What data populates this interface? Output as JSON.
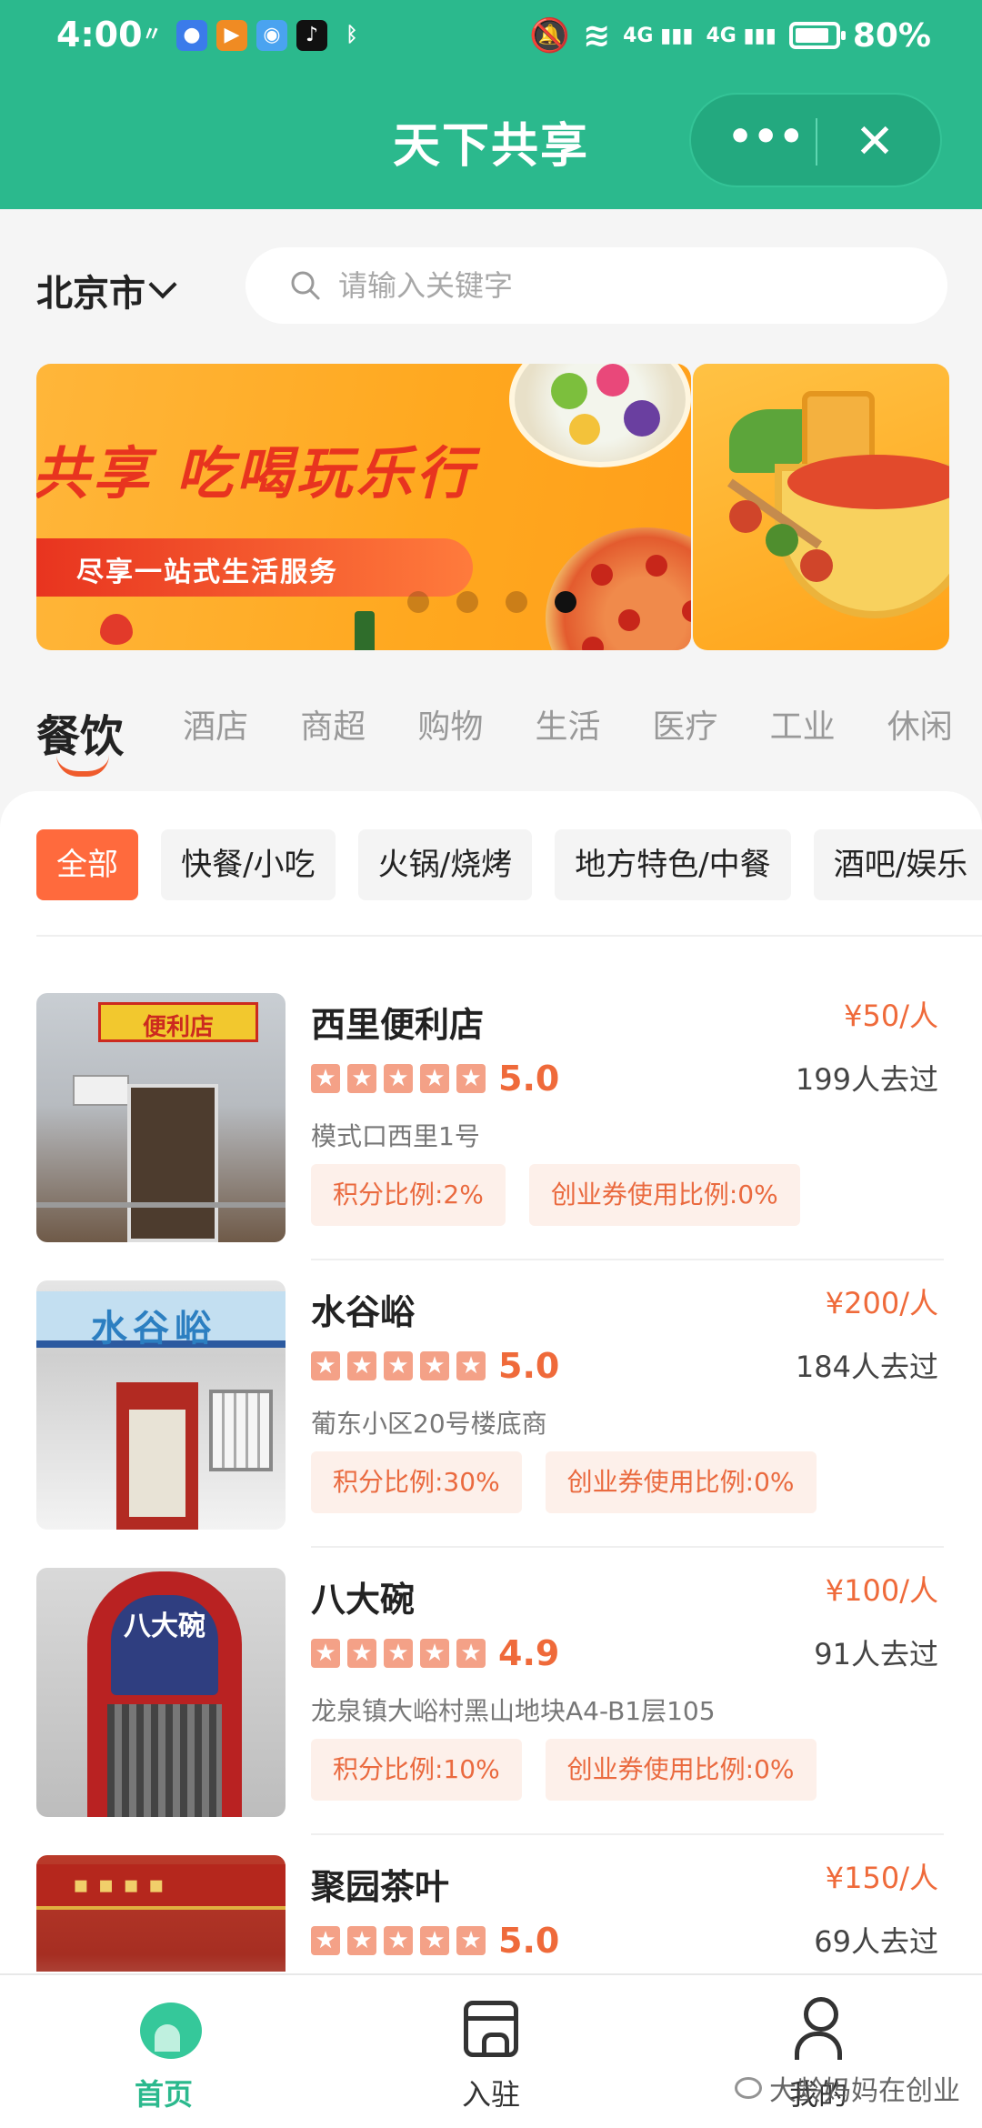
{
  "status_bar": {
    "time": "4:00",
    "battery": "80%",
    "network_1": "4G",
    "network_2": "4G"
  },
  "nav": {
    "title": "天下共享",
    "more_icon": "more-dots-icon",
    "close_icon": "close-icon"
  },
  "location": {
    "city": "北京市"
  },
  "search": {
    "placeholder": "请输入关键字",
    "value": ""
  },
  "banner": {
    "headline": "共享  吃喝玩乐行",
    "subline": "尽享一站式生活服务",
    "dots_total": 4,
    "dots_active_index": 3
  },
  "categories": [
    "餐饮",
    "酒店",
    "商超",
    "购物",
    "生活",
    "医疗",
    "工业",
    "休闲"
  ],
  "active_category": "餐饮",
  "subcategories": [
    "全部",
    "快餐/小吃",
    "火锅/烧烤",
    "地方特色/中餐",
    "酒吧/娱乐"
  ],
  "active_subcategory": "全部",
  "stores": [
    {
      "name": "西里便利店",
      "price": "¥50/人",
      "rating": "5.0",
      "rating_stars": 5,
      "visits": "199人去过",
      "address": "模式口西里1号",
      "points_ratio": "积分比例:2%",
      "voucher_ratio": "创业券使用比例:0%",
      "sign_text": "便利店"
    },
    {
      "name": "水谷峪",
      "price": "¥200/人",
      "rating": "5.0",
      "rating_stars": 5,
      "visits": "184人去过",
      "address": "葡东小区20号楼底商",
      "points_ratio": "积分比例:30%",
      "voucher_ratio": "创业券使用比例:0%",
      "sign_text": "水谷峪"
    },
    {
      "name": "八大碗",
      "price": "¥100/人",
      "rating": "4.9",
      "rating_stars": 5,
      "visits": "91人去过",
      "address": "龙泉镇大峪村黑山地块A4-B1层105",
      "points_ratio": "积分比例:10%",
      "voucher_ratio": "创业券使用比例:0%",
      "sign_text": "八大碗"
    },
    {
      "name": "聚园茶叶",
      "price": "¥150/人",
      "rating": "5.0",
      "rating_stars": 5,
      "visits": "69人去过"
    }
  ],
  "tabbar": {
    "home": "首页",
    "join": "入驻",
    "mine": "我的"
  },
  "watermark": "大龄妈妈在创业",
  "colors": {
    "brand_green": "#2bb98d",
    "accent_orange": "#ef6a3a",
    "tag_bg": "#fdf0ea"
  }
}
